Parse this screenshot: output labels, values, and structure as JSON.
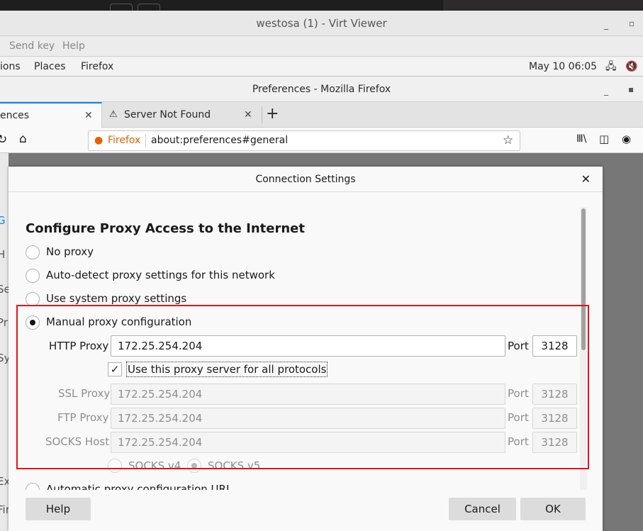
{
  "virt_viewer": {
    "title": "westosa (1) - Virt Viewer",
    "menu": [
      "Send key",
      "Help"
    ]
  },
  "gnome_bar": {
    "items": [
      "ions",
      "Places",
      "Firefox"
    ],
    "clock": "May 10  06:05",
    "icons": [
      "network-icon",
      "volume-muted-icon"
    ]
  },
  "firefox": {
    "window_title": "Preferences - Mozilla Firefox",
    "tabs": [
      {
        "label": "ences",
        "active": true
      },
      {
        "label": "Server Not Found",
        "icon": "warning-icon"
      }
    ],
    "new_tab": "+",
    "url_identity": "Firefox",
    "url": "about:preferences#general",
    "side_letters": [
      "G",
      "H",
      "Se",
      "Pr",
      "Sy",
      "Ex",
      "Fir"
    ]
  },
  "dialog": {
    "title": "Connection Settings",
    "heading": "Configure Proxy Access to the Internet",
    "options": [
      {
        "label": "No proxy",
        "selected": false
      },
      {
        "label": "Auto-detect proxy settings for this network",
        "selected": false
      },
      {
        "label": "Use system proxy settings",
        "selected": false
      },
      {
        "label": "Manual proxy configuration",
        "selected": true
      },
      {
        "label": "Automatic proxy configuration URL",
        "selected": false
      }
    ],
    "http_proxy": {
      "label": "HTTP Proxy",
      "value": "172.25.254.204",
      "port_label": "Port",
      "port": "3128"
    },
    "all_protocols": {
      "label": "Use this proxy server for all protocols",
      "checked": true
    },
    "ssl_proxy": {
      "label": "SSL Proxy",
      "value": "172.25.254.204",
      "port_label": "Port",
      "port": "3128"
    },
    "ftp_proxy": {
      "label": "FTP Proxy",
      "value": "172.25.254.204",
      "port_label": "Port",
      "port": "3128"
    },
    "socks_host": {
      "label": "SOCKS Host",
      "value": "172.25.254.204",
      "port_label": "Port",
      "port": "3128"
    },
    "socks_v4": "SOCKS v4",
    "socks_v5": "SOCKS v5",
    "socks_selected": "SOCKS v5",
    "buttons": {
      "help": "Help",
      "cancel": "Cancel",
      "ok": "OK"
    },
    "highlight_color": "#e0141e"
  }
}
